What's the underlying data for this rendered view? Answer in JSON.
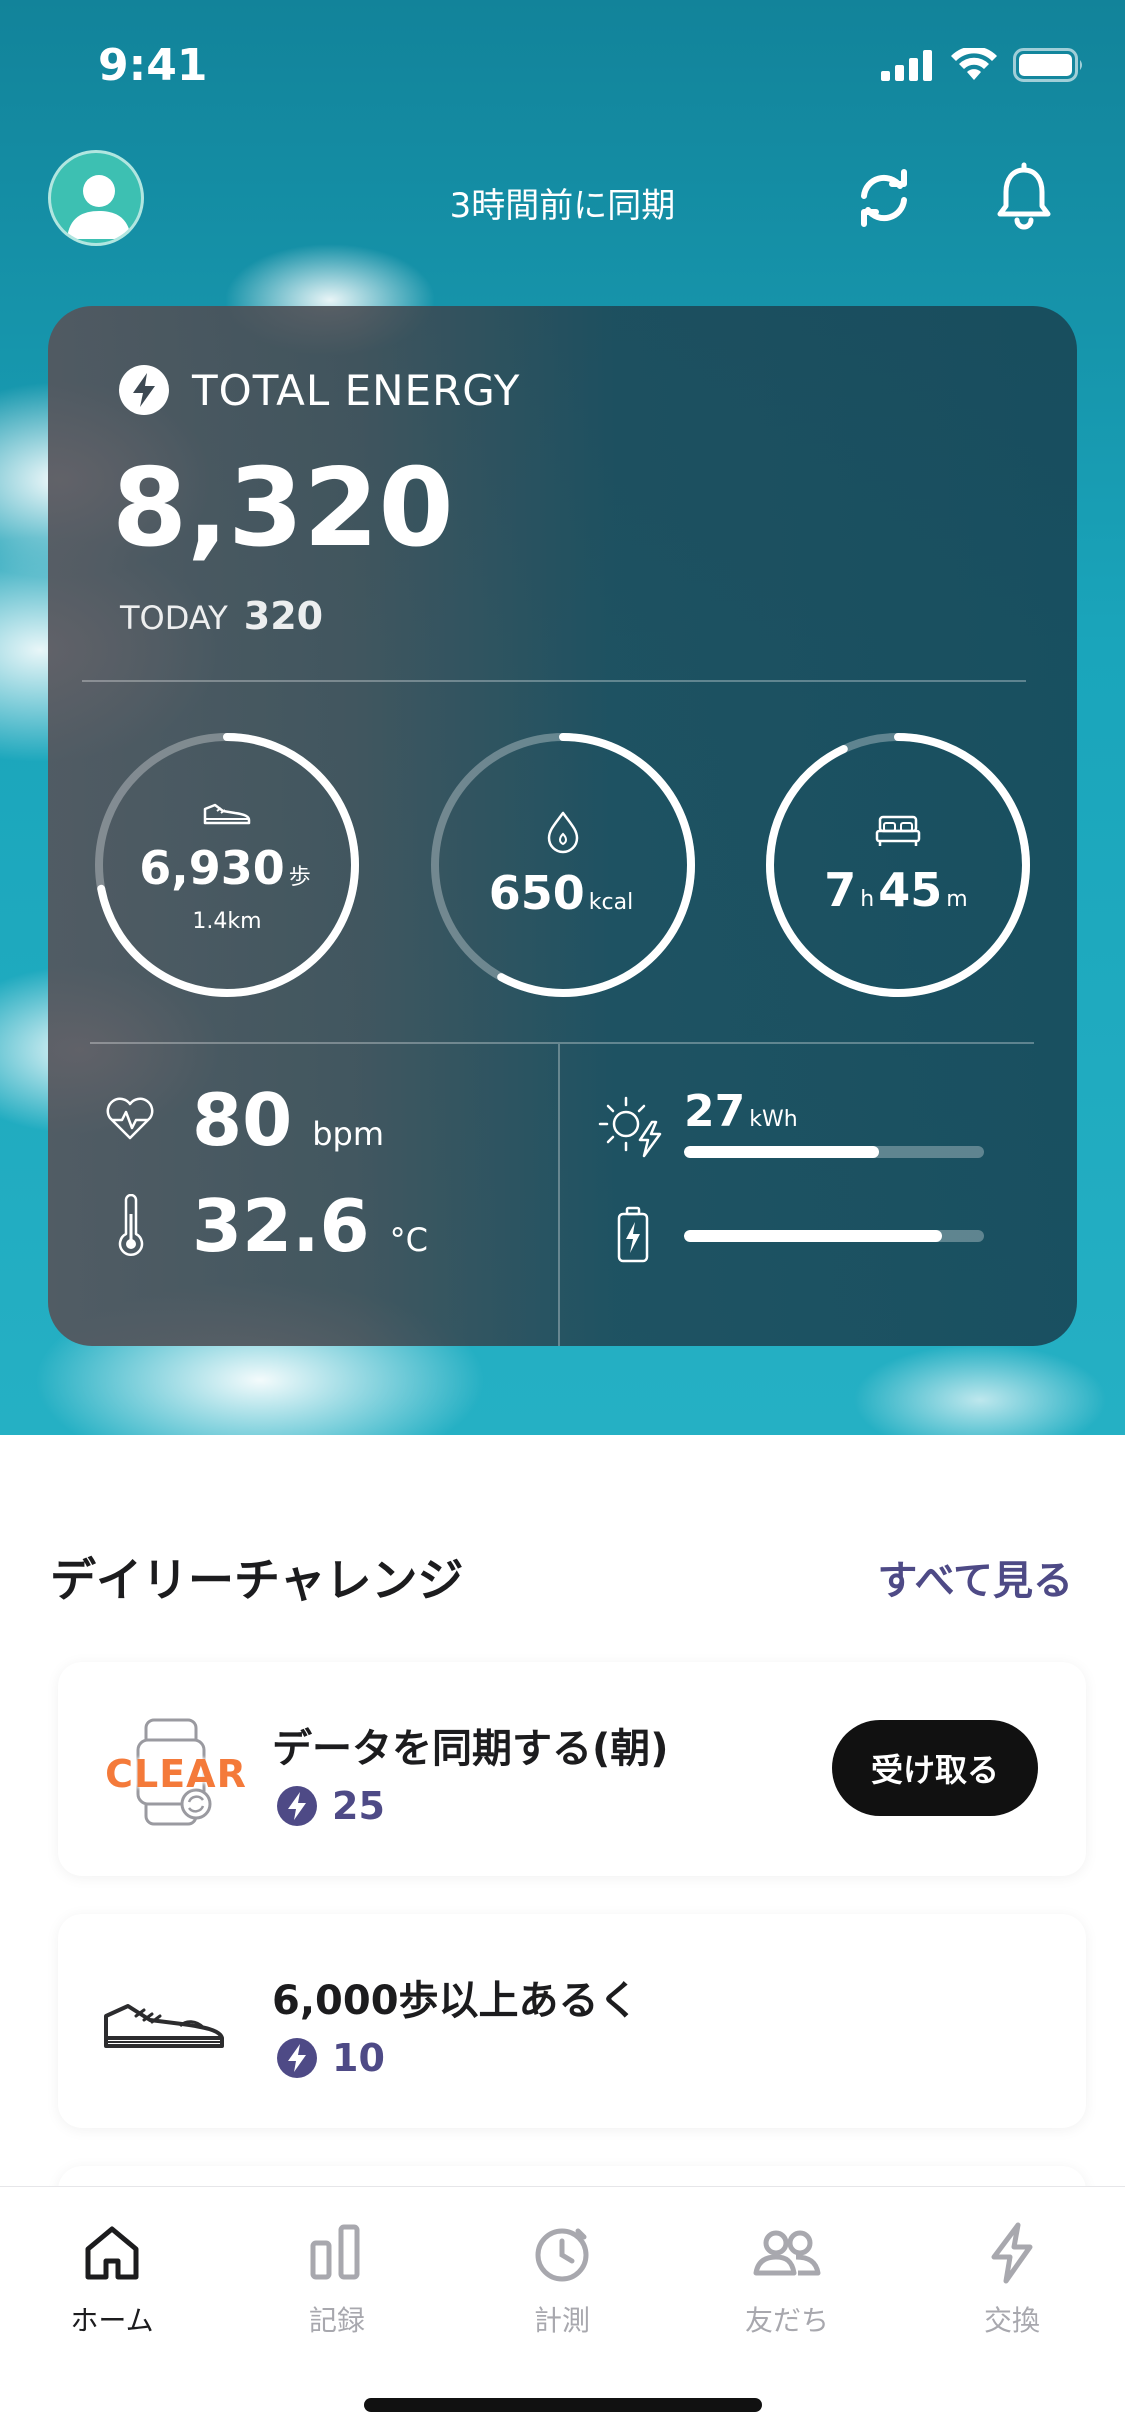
{
  "status": {
    "time": "9:41"
  },
  "header": {
    "sync_text": "3時間前に同期"
  },
  "energy": {
    "title": "TOTAL ENERGY",
    "total": "8,320",
    "today_label": "TODAY",
    "today_value": "320"
  },
  "rings": {
    "steps": {
      "value": "6,930",
      "unit": "歩",
      "sub": "1.4km",
      "progress": 0.72
    },
    "calories": {
      "value": "650",
      "unit": "kcal",
      "progress": 0.58
    },
    "sleep": {
      "hours": "7",
      "h_unit": "h",
      "minutes": "45",
      "m_unit": "m",
      "progress": 0.93
    }
  },
  "vitals": {
    "heart_rate": {
      "value": "80",
      "unit": "bpm"
    },
    "temperature": {
      "value": "32.6",
      "unit": "°C"
    },
    "solar": {
      "value": "27",
      "unit": "kWh",
      "progress": 0.65
    },
    "battery": {
      "progress": 0.86
    }
  },
  "challenges": {
    "title": "デイリーチャレンジ",
    "see_all": "すべて見る",
    "items": [
      {
        "badge": "CLEAR",
        "title": "データを同期する(朝)",
        "points": "25",
        "action": "受け取る"
      },
      {
        "title": "6,000歩以上あるく",
        "points": "10"
      }
    ]
  },
  "tabs": [
    {
      "label": "ホーム",
      "icon": "home-icon",
      "active": true
    },
    {
      "label": "記録",
      "icon": "chart-icon"
    },
    {
      "label": "計測",
      "icon": "stopwatch-icon"
    },
    {
      "label": "友だち",
      "icon": "friends-icon"
    },
    {
      "label": "交換",
      "icon": "bolt-icon"
    }
  ],
  "colors": {
    "accent": "#4e4a86",
    "badge_orange": "#f47a3a",
    "tab_active": "#1c1c1e",
    "tab_inactive": "#a8a8ae"
  }
}
